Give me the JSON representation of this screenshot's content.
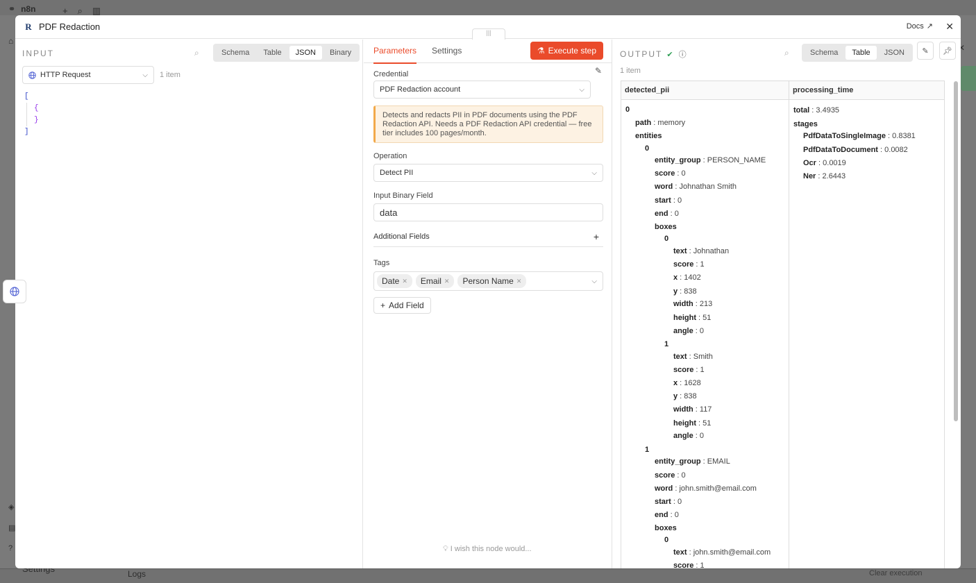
{
  "app": {
    "name": "n8n"
  },
  "background": {
    "settings": "Settings",
    "logs": "Logs",
    "clear_execution": "Clear execution"
  },
  "modal": {
    "title": "PDF Redaction",
    "docs": "Docs"
  },
  "input": {
    "label": "INPUT",
    "tabs": [
      "Schema",
      "Table",
      "JSON",
      "Binary"
    ],
    "active_tab": "JSON",
    "source_node": "HTTP Request",
    "item_count": "1 item",
    "json_lines": [
      "[",
      "{",
      "}",
      "]"
    ]
  },
  "params": {
    "tabs": [
      "Parameters",
      "Settings"
    ],
    "active_tab": "Parameters",
    "execute_label": "Execute step",
    "credential_label": "Credential",
    "credential_value": "PDF Redaction account",
    "note": "Detects and redacts PII in PDF documents using the PDF Redaction API. Needs a PDF Redaction API credential — free tier includes 100 pages/month.",
    "operation_label": "Operation",
    "operation_value": "Detect PII",
    "binary_label": "Input Binary Field",
    "binary_value": "data",
    "additional_label": "Additional Fields",
    "tags_label": "Tags",
    "tags": [
      "Date",
      "Email",
      "Person Name"
    ],
    "add_field_label": "Add Field",
    "wish": "I wish this node would..."
  },
  "output": {
    "label": "OUTPUT",
    "tabs": [
      "Schema",
      "Table",
      "JSON"
    ],
    "active_tab": "Table",
    "item_count": "1 item",
    "columns": [
      "detected_pii",
      "processing_time"
    ],
    "detected_pii": {
      "index": "0",
      "path_key": "path",
      "path_val": "memory",
      "entities_key": "entities",
      "e0": {
        "idx": "0",
        "entity_group": "PERSON_NAME",
        "score": "0",
        "word": "Johnathan Smith",
        "start": "0",
        "end": "0",
        "boxes": [
          {
            "idx": "0",
            "text": "Johnathan",
            "score": "1",
            "x": "1402",
            "y": "838",
            "width": "213",
            "height": "51",
            "angle": "0"
          },
          {
            "idx": "1",
            "text": "Smith",
            "score": "1",
            "x": "1628",
            "y": "838",
            "width": "117",
            "height": "51",
            "angle": "0"
          }
        ]
      },
      "e1": {
        "idx": "1",
        "entity_group": "EMAIL",
        "score": "0",
        "word": "john.smith@email.com",
        "start": "0",
        "end": "0",
        "box0": {
          "idx": "0",
          "text": "john.smith@email.com",
          "score": "1"
        }
      }
    },
    "processing_time": {
      "total": "3.4935",
      "stages_key": "stages",
      "stages": [
        {
          "k": "PdfDataToSingleImage",
          "v": "0.8381"
        },
        {
          "k": "PdfDataToDocument",
          "v": "0.0082"
        },
        {
          "k": "Ocr",
          "v": "0.0019"
        },
        {
          "k": "Ner",
          "v": "2.6443"
        }
      ]
    }
  }
}
